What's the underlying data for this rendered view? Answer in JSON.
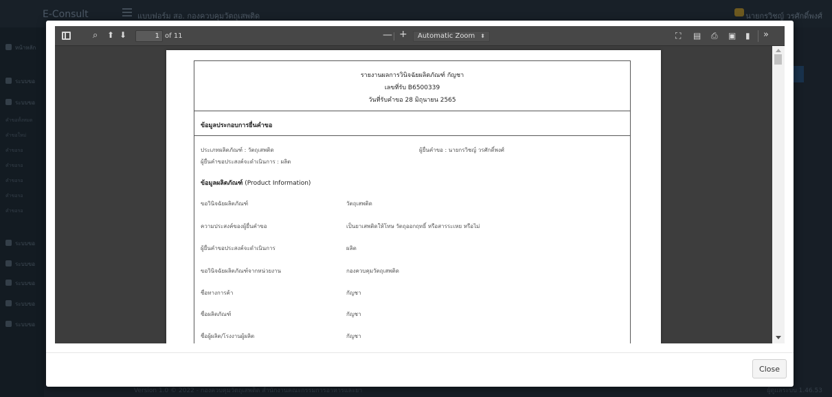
{
  "app": {
    "brand": "E-Consult",
    "subtitle": "แบบฟอร์ม สอ. กองควบคุมวัตถุเสพติด",
    "user_name": "นายกรวิชญ์ วรศักดิ์พงศ์",
    "sidebar": {
      "items": [
        "หน้าหลัก",
        "ระบบขอ",
        "ระบบขอ",
        "ระบบขอ",
        "ระบบขอ",
        "ระบบขอ",
        "ระบบขอ",
        "ระบบขอ"
      ],
      "subitems": [
        "คำขอทั้งหมด",
        "คำขอใหม่",
        "คำขอรอ",
        "คำขอรอ",
        "คำขอรอ",
        "คำขอรอ",
        "คำขอรอ",
        "คำขอรอ"
      ]
    },
    "footer_version": "Version 1.0 © 2022 - กองควบคุมวัตถุเสพติด สำนักงานคณะกรรมการอาหารและยา",
    "footer_right": "ผู้ดูแลระบบ 1.46.53"
  },
  "viewer": {
    "page_number": "1",
    "page_count": "of 11",
    "zoom_label": "Automatic Zoom",
    "icons": {
      "sidebar": "sidebar-toggle-icon",
      "search": "search-icon",
      "prev": "arrow-up-icon",
      "next": "arrow-down-icon",
      "zoom_out": "minus-icon",
      "zoom_in": "plus-icon",
      "presentation": "presentation-mode-icon",
      "open": "open-file-icon",
      "print": "print-icon",
      "save": "save-icon",
      "bookmark": "bookmark-icon",
      "tools": "double-chevron-right-icon"
    },
    "glyphs": {
      "search": "⌕",
      "up": "⬆",
      "down": "⬇",
      "minus": "—",
      "plus": "+",
      "caret": "⬍",
      "present": "⛶",
      "open": "▤",
      "print": "⎙",
      "save": "▣",
      "bookmark": "▮",
      "more": "»"
    }
  },
  "document": {
    "title": "รายงานผลการวินิจฉัยผลิตภัณฑ์ กัญชา",
    "receipt": "เลขที่รับ B6500339",
    "receive_date": "วันที่รับคำขอ 28 มิถุนายน 2565",
    "section_title": "ข้อมูลประกอบการยื่นคำขอ",
    "product_type": "ประเภทผลิตภัณฑ์ : วัตถุเสพติด",
    "applicant": "ผู้ยื่นคำขอ : นายกรวิชญ์ วรศักดิ์พงศ์",
    "intention": "ผู้ยื่นคำขอประสงค์จะดำเนินการ : ผลิต",
    "product_info_heading": "ข้อมูลผลิตภัณฑ์",
    "product_info_heading_en": "(Product Information)",
    "rows": [
      {
        "label": "ขอวินิจฉัยผลิตภัณฑ์",
        "value": "วัตถุเสพติด"
      },
      {
        "label": "ความประสงค์ของผู้ยื่นคำขอ",
        "value": "เป็นยาเสพติดให้โทษ วัตถุออกฤทธิ์ หรือสารระเหย หรือไม่"
      },
      {
        "label": "ผู้ยื่นคำขอประสงค์จะดำเนินการ",
        "value": "ผลิต"
      },
      {
        "label": "ขอวินิจฉัยผลิตภัณฑ์จากหน่วยงาน",
        "value": "กองควบคุมวัตถุเสพติด"
      },
      {
        "label": "ชื่อทางการค้า",
        "value": "กัญชา"
      },
      {
        "label": "ชื่อผลิตภัณฑ์",
        "value": "กัญชา"
      },
      {
        "label": "ชื่อผู้ผลิต/โรงงานผู้ผลิต",
        "value": "กัญชา"
      }
    ]
  },
  "modal": {
    "close_label": "Close"
  }
}
